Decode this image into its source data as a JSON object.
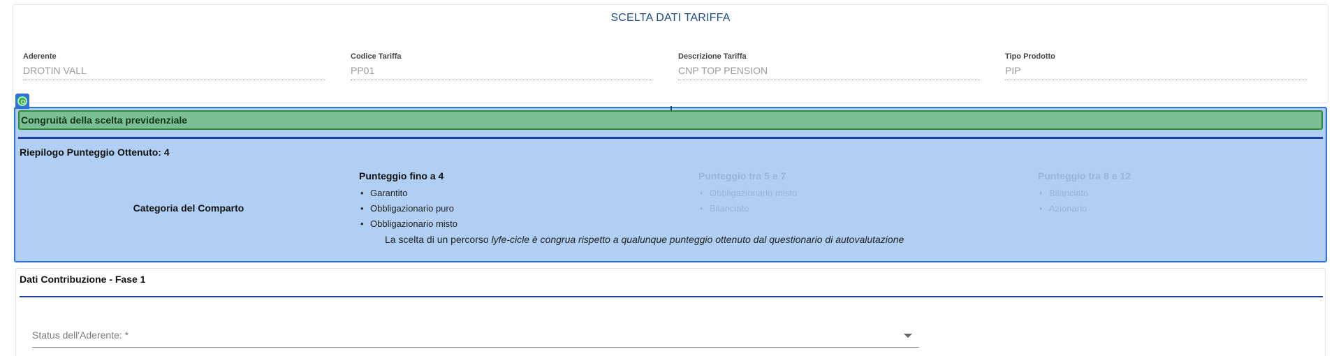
{
  "header": {
    "title": "SCELTA DATI TARIFFA"
  },
  "fields": [
    {
      "label": "Aderente",
      "value": "DROTIN VALL"
    },
    {
      "label": "Codice Tariffa",
      "value": "PP01"
    },
    {
      "label": "Descrizione Tariffa",
      "value": "CNP TOP PENSION"
    },
    {
      "label": "Tipo Prodotto",
      "value": "PIP"
    }
  ],
  "congruita": {
    "title": "Congruità della scelta previdenziale",
    "riepilogo": "Riepilogo Punteggio Ottenuto: 4",
    "category_label": "Categoria del Comparto",
    "columns": [
      {
        "title": "Punteggio fino a 4",
        "active": true,
        "items": [
          "Garantito",
          "Obbligazionario puro",
          "Obbligazionario misto"
        ]
      },
      {
        "title": "Punteggio tra 5 e 7",
        "active": false,
        "items": [
          "Obbligazionario misto",
          "Bilanciato"
        ]
      },
      {
        "title": "Punteggio tra 8 e 12",
        "active": false,
        "items": [
          "Bilanciato",
          "Azionario"
        ]
      }
    ],
    "note_plain": "La scelta di un percorso ",
    "note_italic": "lyfe-cicle è congrua rispetto a qualunque punteggio ottenuto dal questionario di autovalutazione"
  },
  "contribuzione": {
    "title": "Dati Contribuzione - Fase 1",
    "status_placeholder": "Status dell'Aderente: *"
  },
  "icons": {
    "marker": "target-icon",
    "dropdown": "chevron-down-icon"
  },
  "colors": {
    "accent": "#1f4e8c",
    "section_bg": "#b0cff2",
    "section_border": "#2f73d6",
    "success_bar": "#7dbf95"
  }
}
